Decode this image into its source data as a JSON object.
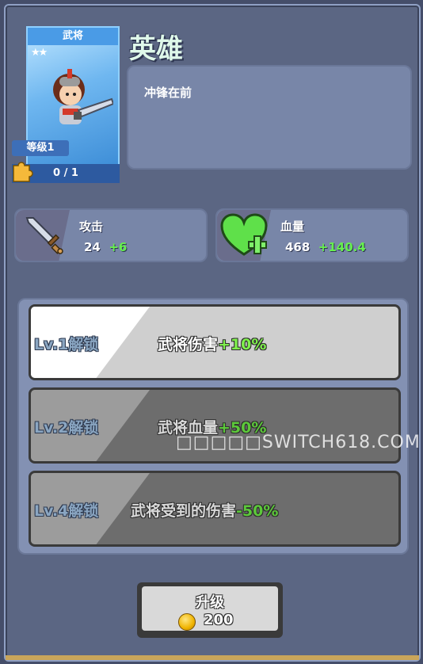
{
  "hero": {
    "card_title": "武将",
    "stars": "★★",
    "level": "等级1",
    "shards": "0 / 1",
    "name": "英雄",
    "description": "冲锋在前"
  },
  "stats": {
    "attack": {
      "label": "攻击",
      "value": "24",
      "bonus": "+6",
      "icon": "sword-icon"
    },
    "health": {
      "label": "血量",
      "value": "468",
      "bonus": "+140.4",
      "icon": "heart-plus-icon"
    }
  },
  "unlocks": [
    {
      "level": "Lv.1解锁",
      "effect": "武将伤害",
      "value": "+10%",
      "state": "active"
    },
    {
      "level": "Lv.2解锁",
      "effect": "武将血量",
      "value": "+50%",
      "state": "locked"
    },
    {
      "level": "Lv.4解锁",
      "effect": "武将受到的伤害",
      "value": "-50%",
      "state": "locked"
    }
  ],
  "upgrade": {
    "label": "升级",
    "cost": "200",
    "icon": "gold-coin-icon"
  },
  "watermark": "□□□□□SWITCH618.COM",
  "colors": {
    "bonus_green": "#67f04f",
    "panel": "#7886a8",
    "background": "#5b6683"
  }
}
